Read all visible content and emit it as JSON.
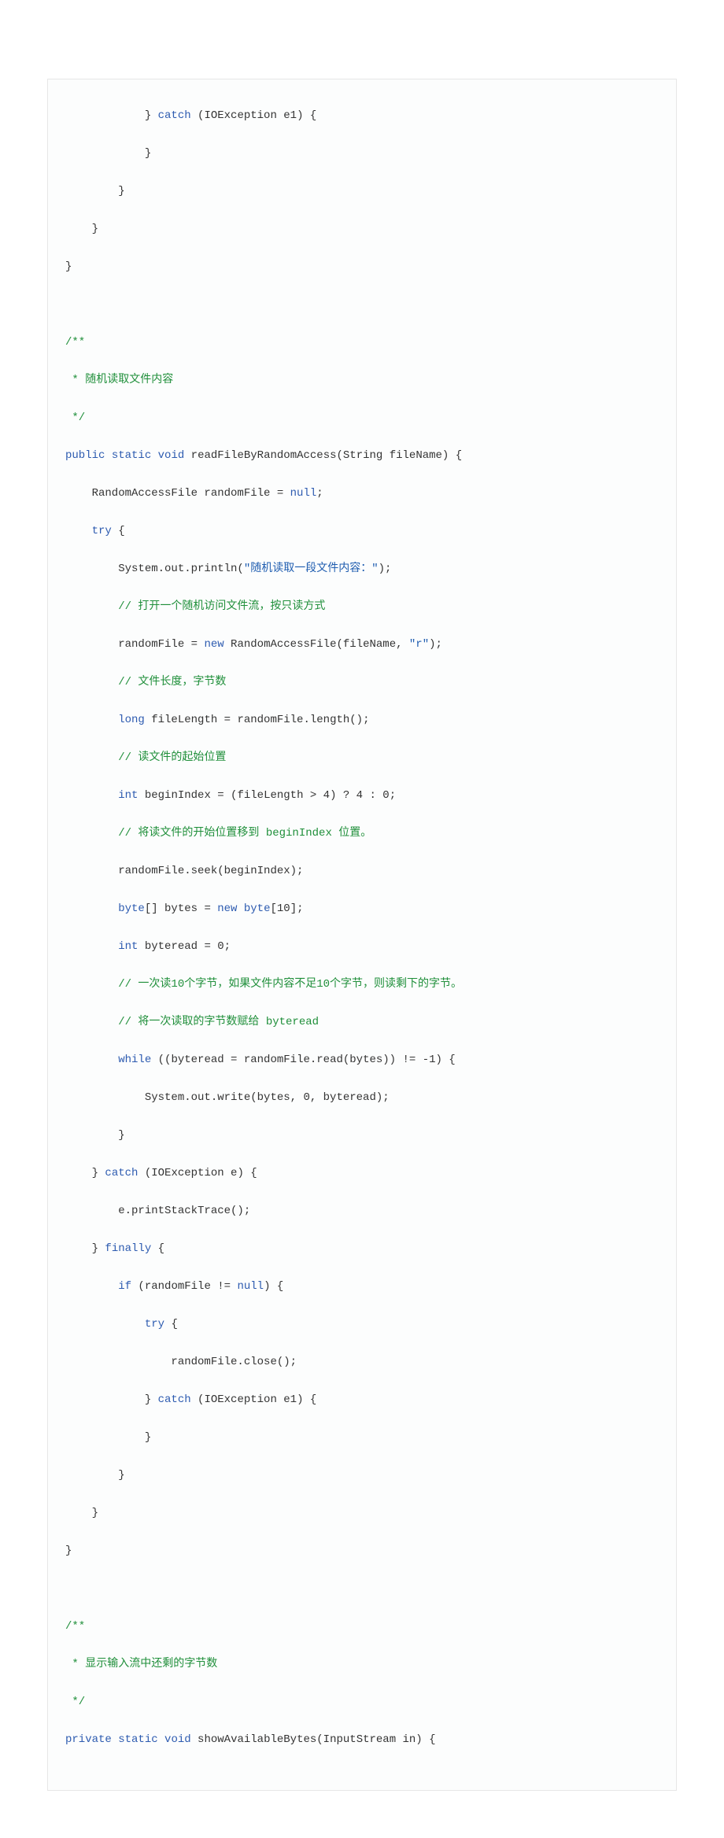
{
  "code": {
    "l01_i": "            } ",
    "l01_kw": "catch",
    "l01_r": " (IOException e1) {",
    "l02": "            }",
    "l03": "        }",
    "l04": "    }",
    "l05": "}",
    "l06": "",
    "l07": "/**",
    "l08": " * 随机读取文件内容",
    "l09": " */",
    "l10_a": "public",
    "l10_b": " ",
    "l10_c": "static",
    "l10_d": " ",
    "l10_e": "void",
    "l10_f": " readFileByRandomAccess(String fileName) {",
    "l11_a": "    RandomAccessFile randomFile = ",
    "l11_b": "null",
    "l11_c": ";",
    "l12_a": "    ",
    "l12_b": "try",
    "l12_c": " {",
    "l13_a": "        System.out.println(",
    "l13_b": "\"随机读取一段文件内容：\"",
    "l13_c": ");",
    "l14": "        // 打开一个随机访问文件流，按只读方式",
    "l15_a": "        randomFile = ",
    "l15_b": "new",
    "l15_c": " RandomAccessFile(fileName, ",
    "l15_d": "\"r\"",
    "l15_e": ");",
    "l16": "        // 文件长度，字节数",
    "l17_a": "        ",
    "l17_b": "long",
    "l17_c": " fileLength = randomFile.length();",
    "l18": "        // 读文件的起始位置",
    "l19_a": "        ",
    "l19_b": "int",
    "l19_c": " beginIndex = (fileLength > 4) ? 4 : 0;",
    "l20_a": "        // 将读文件的开始位置移到 ",
    "l20_b": "beginIndex",
    "l20_c": " 位置。",
    "l21": "        randomFile.seek(beginIndex);",
    "l22_a": "        ",
    "l22_b": "byte",
    "l22_c": "[] bytes = ",
    "l22_d": "new",
    "l22_e": " ",
    "l22_f": "byte",
    "l22_g": "[10];",
    "l23_a": "        ",
    "l23_b": "int",
    "l23_c": " byteread = 0;",
    "l24": "        // 一次读10个字节，如果文件内容不足10个字节，则读剩下的字节。",
    "l25_a": "        // 将一次读取的字节数赋给 ",
    "l25_b": "byteread",
    "l26_a": "        ",
    "l26_b": "while",
    "l26_c": " ((byteread = randomFile.read(bytes)) != -1) {",
    "l27": "            System.out.write(bytes, 0, byteread);",
    "l28": "        }",
    "l29_a": "    } ",
    "l29_b": "catch",
    "l29_c": " (IOException e) {",
    "l30": "        e.printStackTrace();",
    "l31_a": "    } ",
    "l31_b": "finally",
    "l31_c": " {",
    "l32_a": "        ",
    "l32_b": "if",
    "l32_c": " (randomFile != ",
    "l32_d": "null",
    "l32_e": ") {",
    "l33_a": "            ",
    "l33_b": "try",
    "l33_c": " {",
    "l34": "                randomFile.close();",
    "l35_a": "            } ",
    "l35_b": "catch",
    "l35_c": " (IOException e1) {",
    "l36": "            }",
    "l37": "        }",
    "l38": "    }",
    "l39": "}",
    "l40": "",
    "l41": "/**",
    "l42": " * 显示输入流中还剩的字节数",
    "l43": " */",
    "l44_a": "private",
    "l44_b": " ",
    "l44_c": "static",
    "l44_d": " ",
    "l44_e": "void",
    "l44_f": " showAvailableBytes(InputStream in) {"
  }
}
